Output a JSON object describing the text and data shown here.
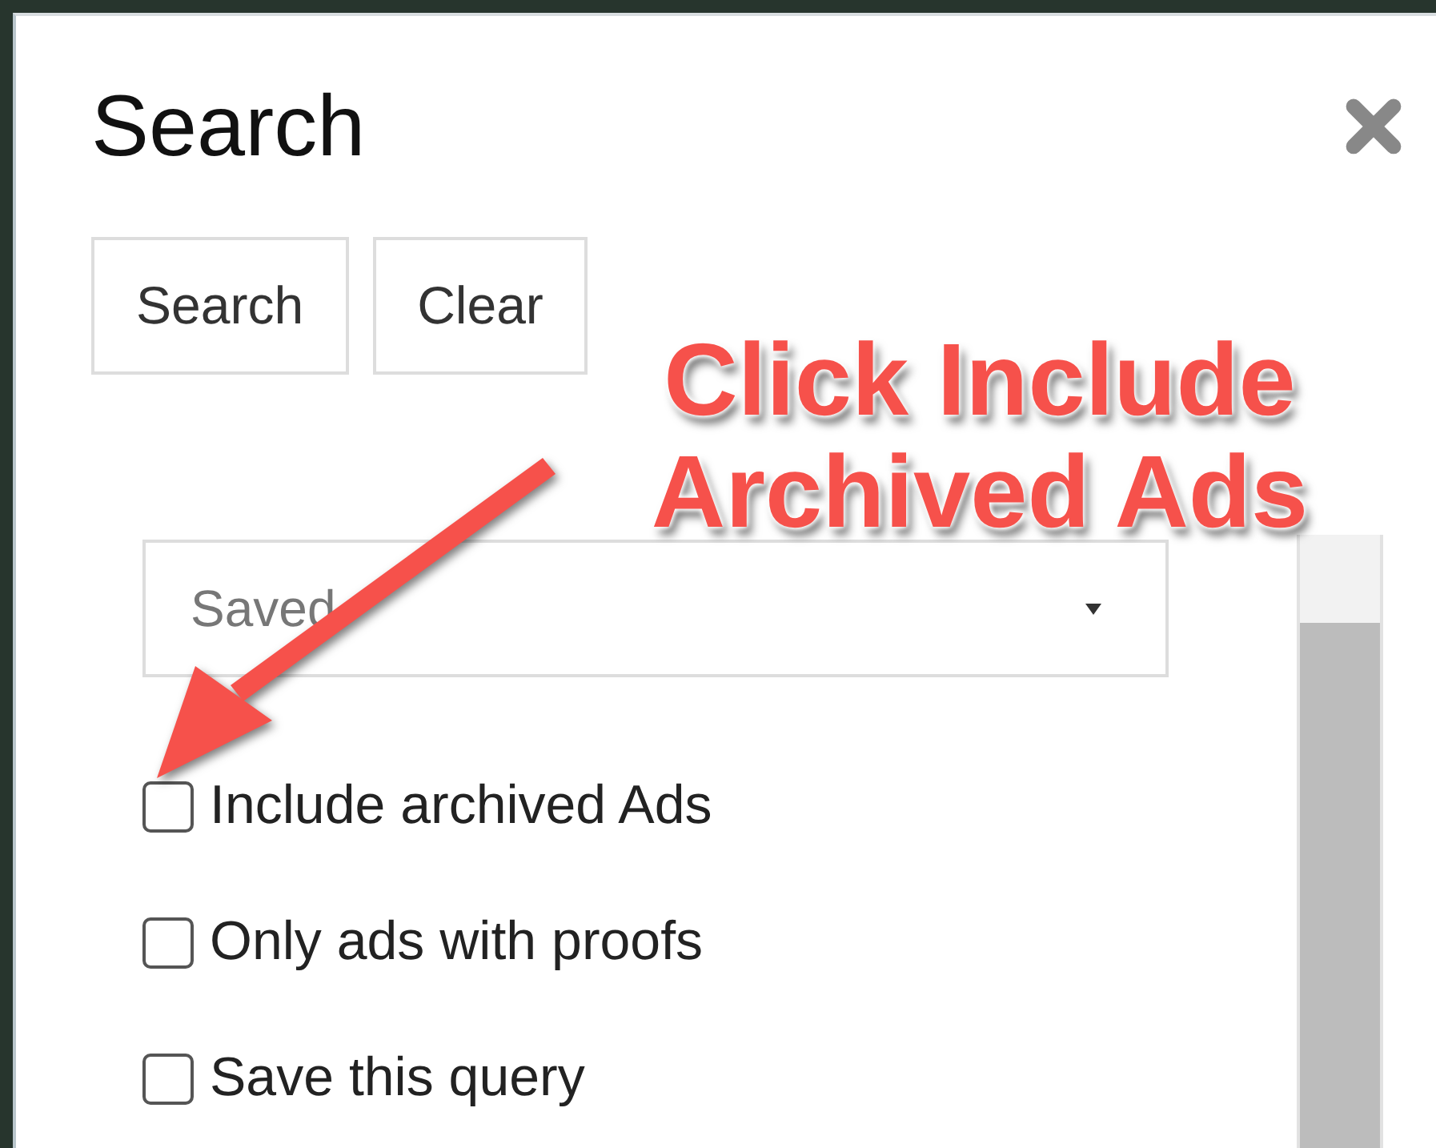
{
  "dialog": {
    "title": "Search"
  },
  "buttons": [
    {
      "label": "Search"
    },
    {
      "label": "Clear"
    }
  ],
  "saved_queries": {
    "placeholder": "Saved"
  },
  "options": [
    {
      "label": "Include archived Ads",
      "checked": false
    },
    {
      "label": "Only ads with proofs",
      "checked": false
    },
    {
      "label": "Save this query",
      "checked": false
    }
  ],
  "annotation": {
    "text": "Click Include Archived Ads"
  }
}
